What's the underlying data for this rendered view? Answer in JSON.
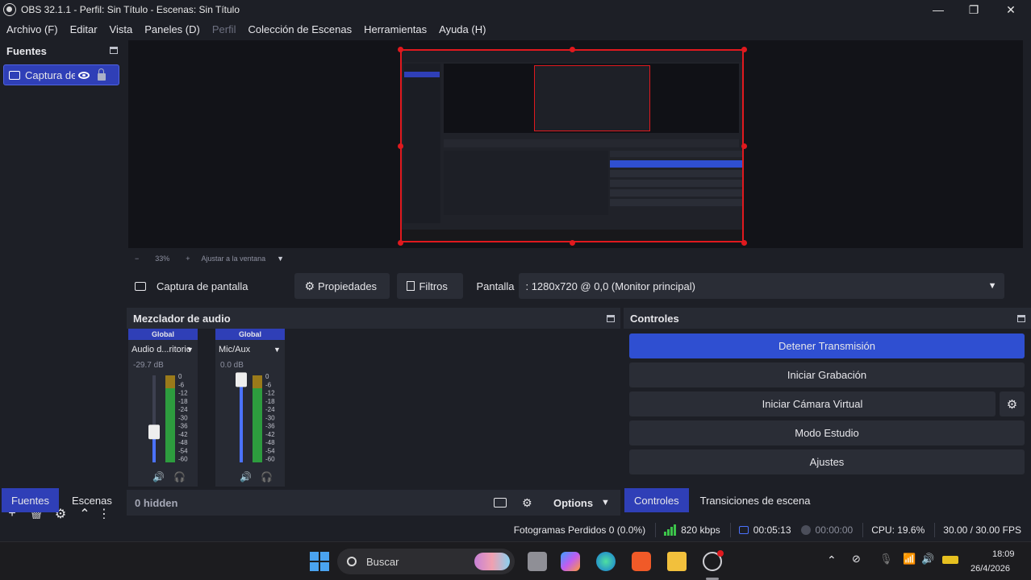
{
  "window": {
    "title": "OBS 32.1.1 - Perfil: Sin Título - Escenas: Sin Título",
    "minimize": "—",
    "maximize": "❐",
    "close": "✕"
  },
  "menu": [
    {
      "label": "Archivo (F)",
      "disabled": false
    },
    {
      "label": "Editar",
      "disabled": false
    },
    {
      "label": "Vista",
      "disabled": false
    },
    {
      "label": "Paneles (D)",
      "disabled": false
    },
    {
      "label": "Perfil",
      "disabled": true
    },
    {
      "label": "Colección de Escenas",
      "disabled": false
    },
    {
      "label": "Herramientas",
      "disabled": false
    },
    {
      "label": "Ayuda (H)",
      "disabled": false
    }
  ],
  "sources": {
    "title": "Fuentes",
    "items": [
      {
        "label": "Captura de pantalla"
      }
    ],
    "toolbar": {
      "add": "+",
      "remove": "🗑",
      "settings": "⚙",
      "up": "⌃",
      "more": "⋮"
    }
  },
  "bottom_tabs_left": {
    "sources": "Fuentes",
    "scenes": "Escenas"
  },
  "zoom_bar": {
    "minus": "−",
    "zoom": "33%",
    "plus": "+",
    "fit": "Ajustar a la ventana",
    "arrow": "▼"
  },
  "context_bar": {
    "source_name": "Captura de pantalla",
    "properties": "Propiedades",
    "filters": "Filtros",
    "display_label": "Pantalla",
    "display_value": ": 1280x720 @ 0,0 (Monitor principal)"
  },
  "mixer": {
    "title": "Mezclador de audio",
    "channels": [
      {
        "global": "Global",
        "name": "Audio d...ritorio",
        "db": "-29.7 dB",
        "level": 0.35
      },
      {
        "global": "Global",
        "name": "Mic/Aux",
        "db": "0.0 dB",
        "level": 0.95
      }
    ],
    "scale": [
      "0",
      "-6",
      "-12",
      "-18",
      "-24",
      "-30",
      "-36",
      "-42",
      "-48",
      "-54",
      "-60"
    ],
    "hidden": "0 hidden",
    "options": "Options"
  },
  "controls": {
    "title": "Controles",
    "stop_stream": "Detener Transmisión",
    "start_recording": "Iniciar Grabación",
    "start_virtual_cam": "Iniciar Cámara Virtual",
    "studio_mode": "Modo Estudio",
    "settings": "Ajustes"
  },
  "bottom_tabs_right": {
    "controls": "Controles",
    "transitions": "Transiciones de escena"
  },
  "status": {
    "dropped": "Fotogramas Perdidos 0 (0.0%)",
    "bitrate": "820 kbps",
    "stream_time": "00:05:13",
    "rec_time": "00:00:00",
    "cpu": "CPU: 19.6%",
    "fps": "30.00 / 30.00 FPS"
  },
  "taskbar": {
    "search": "Buscar",
    "time": "18:09",
    "date": "26/4/2026"
  },
  "colors": {
    "accent": "#2f4fd1",
    "selection_red": "#e0191e",
    "panel": "#272a33",
    "background": "#1d1f26"
  }
}
